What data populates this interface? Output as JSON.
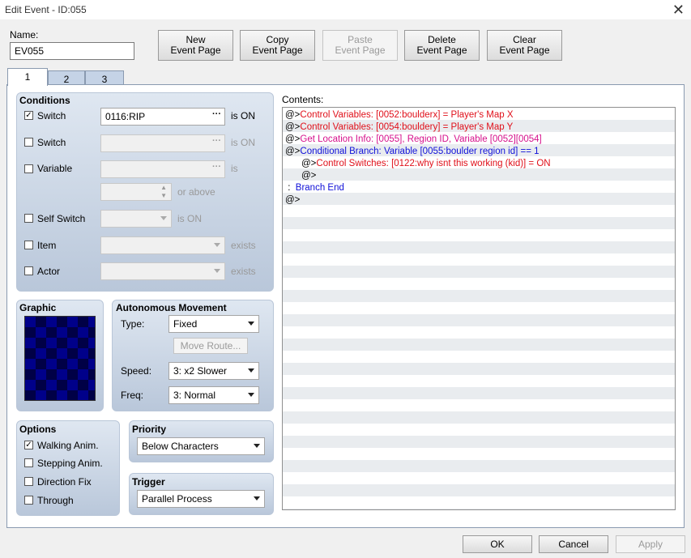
{
  "window": {
    "title": "Edit Event - ID:055",
    "close_glyph": "✕"
  },
  "name": {
    "label": "Name:",
    "value": "EV055"
  },
  "toolbar": {
    "new_page": [
      "New",
      "Event Page"
    ],
    "copy_page": [
      "Copy",
      "Event Page"
    ],
    "paste_page": [
      "Paste",
      "Event Page"
    ],
    "delete_page": [
      "Delete",
      "Event Page"
    ],
    "clear_page": [
      "Clear",
      "Event Page"
    ]
  },
  "tabs": [
    "1",
    "2",
    "3"
  ],
  "conditions": {
    "title": "Conditions",
    "switch1": {
      "label": "Switch",
      "checked": true,
      "value": "0116:RIP",
      "suffix": "is ON"
    },
    "switch2": {
      "label": "Switch",
      "checked": false,
      "value": "",
      "suffix": "is ON"
    },
    "variable": {
      "label": "Variable",
      "checked": false,
      "value": "",
      "suffix": "is",
      "suffix2": "or above"
    },
    "self_switch": {
      "label": "Self Switch",
      "checked": false,
      "suffix": "is ON"
    },
    "item": {
      "label": "Item",
      "checked": false,
      "suffix": "exists"
    },
    "actor": {
      "label": "Actor",
      "checked": false,
      "suffix": "exists"
    }
  },
  "graphic": {
    "title": "Graphic"
  },
  "autonomous": {
    "title": "Autonomous Movement",
    "type_label": "Type:",
    "type_value": "Fixed",
    "move_route": "Move Route...",
    "speed_label": "Speed:",
    "speed_value": "3: x2 Slower",
    "freq_label": "Freq:",
    "freq_value": "3: Normal"
  },
  "options": {
    "title": "Options",
    "walking": {
      "label": "Walking Anim.",
      "checked": true
    },
    "stepping": {
      "label": "Stepping Anim.",
      "checked": false
    },
    "direction_fix": {
      "label": "Direction Fix",
      "checked": false
    },
    "through": {
      "label": "Through",
      "checked": false
    }
  },
  "priority": {
    "title": "Priority",
    "value": "Below Characters"
  },
  "trigger": {
    "title": "Trigger",
    "value": "Parallel Process"
  },
  "contents": {
    "label": "Contents:",
    "lines": [
      {
        "prefix": "@>",
        "text": "Control Variables: [0052:boulderx] = Player's Map X",
        "color": "#e0101a",
        "indent": 0
      },
      {
        "prefix": "@>",
        "text": "Control Variables: [0054:bouldery] = Player's Map Y",
        "color": "#e0101a",
        "indent": 0
      },
      {
        "prefix": "@>",
        "text": "Get Location Info: [0055], Region ID, Variable [0052][0054]",
        "color": "#d6108c",
        "indent": 0
      },
      {
        "prefix": "@>",
        "text": "Conditional Branch: Variable [0055:boulder region id] == 1",
        "color": "#1010d8",
        "indent": 0
      },
      {
        "prefix": "@>",
        "text": "Control Switches: [0122:why isnt this working (kid)] = ON",
        "color": "#e0101a",
        "indent": 1
      },
      {
        "prefix": "@>",
        "text": "",
        "color": "#000000",
        "indent": 1
      },
      {
        "prefix": " :  ",
        "text": "Branch End",
        "color": "#1010d8",
        "indent": 0
      },
      {
        "prefix": "@>",
        "text": "",
        "color": "#000000",
        "indent": 0
      }
    ]
  },
  "footer": {
    "ok": "OK",
    "cancel": "Cancel",
    "apply": "Apply"
  }
}
